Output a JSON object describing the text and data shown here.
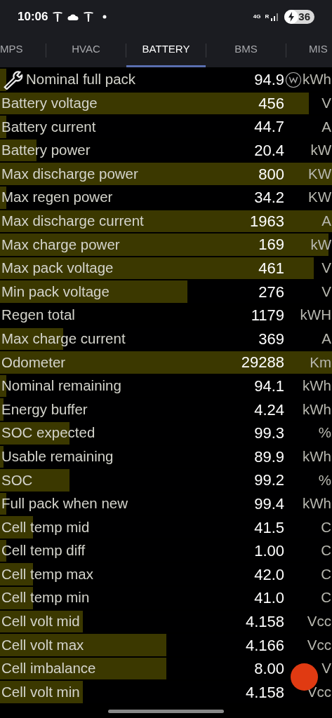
{
  "status_bar": {
    "time": "10:06",
    "network": "4G",
    "roaming": "R",
    "battery": "36"
  },
  "tabs": [
    {
      "label": "MPS",
      "selected": false
    },
    {
      "label": "HVAC",
      "selected": false
    },
    {
      "label": "BATTERY",
      "selected": true
    },
    {
      "label": "BMS",
      "selected": false
    },
    {
      "label": "MIS",
      "selected": false
    }
  ],
  "rows": [
    {
      "label": "Nominal full pack",
      "value": "94.9",
      "unit": "kWh",
      "level": 0.02
    },
    {
      "label": "Battery voltage",
      "value": "456",
      "unit": "V",
      "level": 0.93
    },
    {
      "label": "Battery current",
      "value": "44.7",
      "unit": "A",
      "level": 0.02
    },
    {
      "label": "Battery power",
      "value": "20.4",
      "unit": "kW",
      "level": 0.11
    },
    {
      "label": "Max discharge power",
      "value": "800",
      "unit": "KW",
      "level": 1
    },
    {
      "label": "Max regen power",
      "value": "34.2",
      "unit": "KW",
      "level": 0.02
    },
    {
      "label": "Max discharge current",
      "value": "1963",
      "unit": "A",
      "level": 1
    },
    {
      "label": "Max charge power",
      "value": "169",
      "unit": "kW",
      "level": 0.99
    },
    {
      "label": "Max pack voltage",
      "value": "461",
      "unit": "V",
      "level": 0.945
    },
    {
      "label": "Min pack voltage",
      "value": "276",
      "unit": "V",
      "level": 0.565
    },
    {
      "label": "Regen total",
      "value": "1179",
      "unit": "kWH"
    },
    {
      "label": "Max charge current",
      "value": "369",
      "unit": "A",
      "level": 0.19
    },
    {
      "label": "Odometer",
      "value": "29288",
      "unit": "Km",
      "level": 1
    },
    {
      "label": "Nominal remaining",
      "value": "94.1",
      "unit": "kWh",
      "level": 0.02
    },
    {
      "label": "Energy buffer",
      "value": "4.24",
      "unit": "kWh",
      "level": 0.01
    },
    {
      "label": "SOC expected",
      "value": "99.3",
      "unit": "%",
      "level": 0.21
    },
    {
      "label": "Usable remaining",
      "value": "89.9",
      "unit": "kWh",
      "level": 0.01
    },
    {
      "label": "SOC",
      "value": "99.2",
      "unit": "%",
      "level": 0.21
    },
    {
      "label": "Full pack when new",
      "value": "99.4",
      "unit": "kWh",
      "level": 0.02
    },
    {
      "label": "Cell temp mid",
      "value": "41.5",
      "unit": "C",
      "level": 0.1
    },
    {
      "label": "Cell temp diff",
      "value": "1.00",
      "unit": "C",
      "level": 0.02
    },
    {
      "label": "Cell temp max",
      "value": "42.0",
      "unit": "C",
      "level": 0.1
    },
    {
      "label": "Cell temp min",
      "value": "41.0",
      "unit": "C",
      "level": 0.1
    },
    {
      "label": "Cell volt mid",
      "value": "4.158",
      "unit": "Vcc",
      "level": 0.25
    },
    {
      "label": "Cell volt max",
      "value": "4.166",
      "unit": "Vcc",
      "level": 0.5
    },
    {
      "label": "Cell imbalance",
      "value": "8.00",
      "unit": "V",
      "level": 0.5
    },
    {
      "label": "Cell volt min",
      "value": "4.158",
      "unit": "Vcc",
      "level": 0.25
    }
  ]
}
